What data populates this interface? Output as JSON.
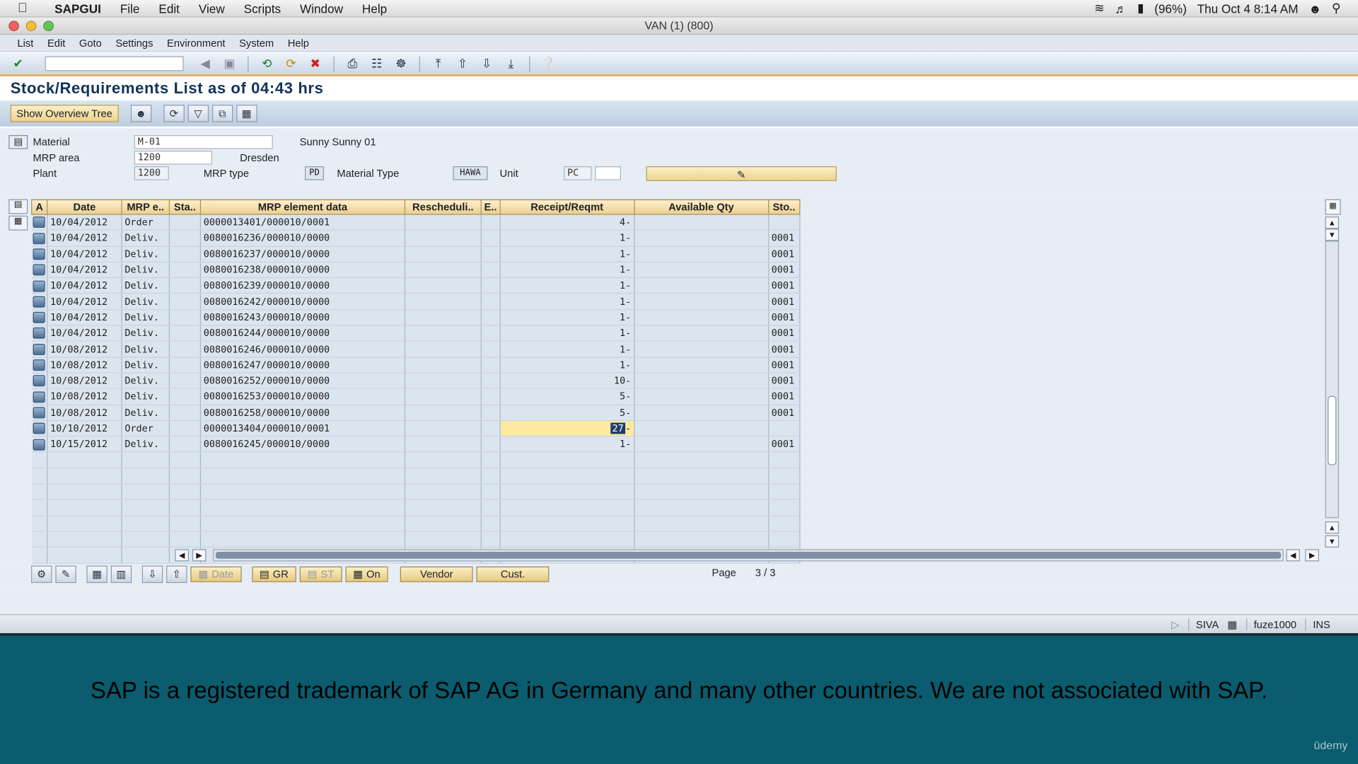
{
  "macmenu": {
    "app": "SAPGUI",
    "items": [
      "File",
      "Edit",
      "View",
      "Scripts",
      "Window",
      "Help"
    ],
    "battery": "(96%)",
    "clock": "Thu Oct 4  8:14 AM"
  },
  "window": {
    "title": "VAN (1) (800)"
  },
  "sapmenu": {
    "items": [
      "List",
      "Edit",
      "Goto",
      "Settings",
      "Environment",
      "System",
      "Help"
    ]
  },
  "page": {
    "title": "Stock/Requirements List as of 04:43 hrs"
  },
  "apptoolbar": {
    "overview_button": "Show Overview Tree"
  },
  "header": {
    "material_label": "Material",
    "material_value": "M-01",
    "material_desc": "Sunny Sunny 01",
    "mrp_area_label": "MRP area",
    "mrp_area_value": "1200",
    "mrp_area_desc": "Dresden",
    "plant_label": "Plant",
    "plant_value": "1200",
    "mrp_type_label": "MRP type",
    "mrp_type_value": "PD",
    "material_type_label": "Material Type",
    "material_type_value": "HAWA",
    "unit_label": "Unit",
    "unit_value": "PC"
  },
  "grid": {
    "columns": [
      "A",
      "Date",
      "MRP e..",
      "Sta..",
      "MRP element data",
      "Rescheduli..",
      "E..",
      "Receipt/Reqmt",
      "Available Qty",
      "Sto.."
    ],
    "rows": [
      {
        "date": "10/04/2012",
        "mrp": "Order",
        "data": "0000013401/000010/0001",
        "qty": "4-",
        "sto": ""
      },
      {
        "date": "10/04/2012",
        "mrp": "Deliv.",
        "data": "0080016236/000010/0000",
        "qty": "1-",
        "sto": "0001"
      },
      {
        "date": "10/04/2012",
        "mrp": "Deliv.",
        "data": "0080016237/000010/0000",
        "qty": "1-",
        "sto": "0001"
      },
      {
        "date": "10/04/2012",
        "mrp": "Deliv.",
        "data": "0080016238/000010/0000",
        "qty": "1-",
        "sto": "0001"
      },
      {
        "date": "10/04/2012",
        "mrp": "Deliv.",
        "data": "0080016239/000010/0000",
        "qty": "1-",
        "sto": "0001"
      },
      {
        "date": "10/04/2012",
        "mrp": "Deliv.",
        "data": "0080016242/000010/0000",
        "qty": "1-",
        "sto": "0001"
      },
      {
        "date": "10/04/2012",
        "mrp": "Deliv.",
        "data": "0080016243/000010/0000",
        "qty": "1-",
        "sto": "0001"
      },
      {
        "date": "10/04/2012",
        "mrp": "Deliv.",
        "data": "0080016244/000010/0000",
        "qty": "1-",
        "sto": "0001"
      },
      {
        "date": "10/08/2012",
        "mrp": "Deliv.",
        "data": "0080016246/000010/0000",
        "qty": "1-",
        "sto": "0001"
      },
      {
        "date": "10/08/2012",
        "mrp": "Deliv.",
        "data": "0080016247/000010/0000",
        "qty": "1-",
        "sto": "0001"
      },
      {
        "date": "10/08/2012",
        "mrp": "Deliv.",
        "data": "0080016252/000010/0000",
        "qty": "10-",
        "sto": "0001"
      },
      {
        "date": "10/08/2012",
        "mrp": "Deliv.",
        "data": "0080016253/000010/0000",
        "qty": "5-",
        "sto": "0001"
      },
      {
        "date": "10/08/2012",
        "mrp": "Deliv.",
        "data": "0080016258/000010/0000",
        "qty": "5-",
        "sto": "0001"
      },
      {
        "date": "10/10/2012",
        "mrp": "Order",
        "data": "0000013404/000010/0001",
        "qty": "27",
        "sto": "",
        "highlight": true
      },
      {
        "date": "10/15/2012",
        "mrp": "Deliv.",
        "data": "0080016245/000010/0000",
        "qty": "1-",
        "sto": "0001"
      }
    ],
    "empty_rows": 7
  },
  "bottombar": {
    "date_button": "Date",
    "gr_button": "GR",
    "st_button": "ST",
    "on_button": "On",
    "vendor_button": "Vendor",
    "cust_button": "Cust.",
    "page_label": "Page",
    "page_current": "3",
    "page_sep": "/",
    "page_total": "3"
  },
  "statusbar": {
    "user": "SIVA",
    "host": "fuze1000",
    "mode": "INS"
  },
  "banner": {
    "text": "SAP is a registered trademark of SAP AG in Germany and many other countries. We are not associated with SAP.",
    "brand": "ūdemy"
  },
  "colors": {
    "accent_orange": "#e8a33c",
    "banner_teal": "#0a5c6e",
    "title_blue": "#11325a",
    "highlight_yellow": "#fdeaa1"
  }
}
